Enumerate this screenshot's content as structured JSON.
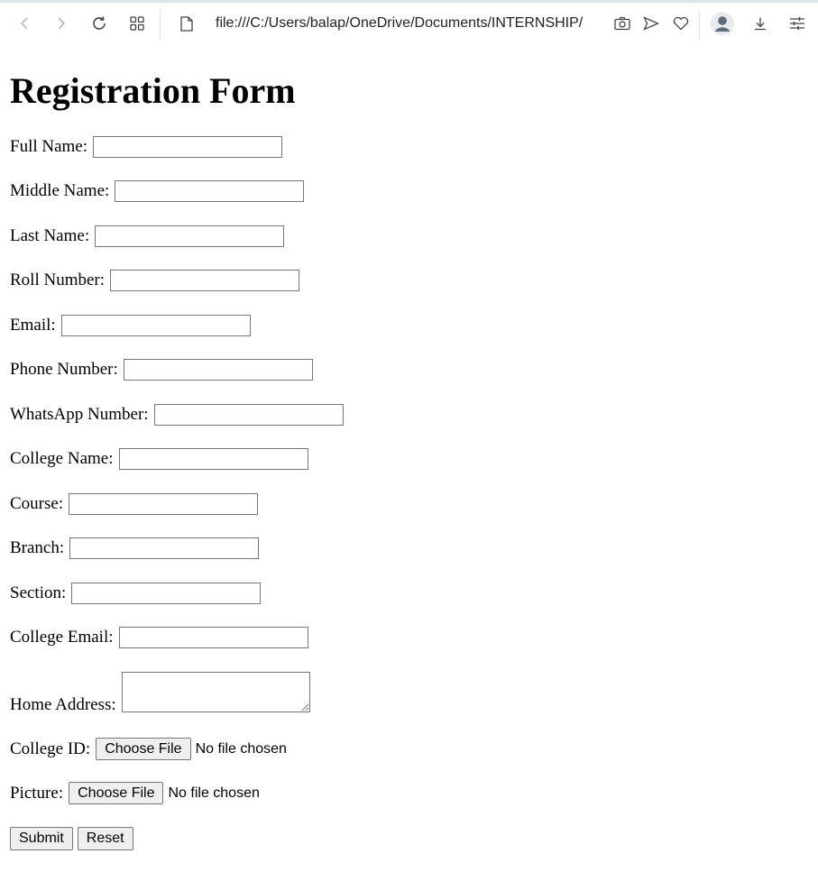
{
  "browser": {
    "url": "file:///C:/Users/balap/OneDrive/Documents/INTERNSHIP/"
  },
  "form": {
    "title": "Registration Form",
    "fields": [
      {
        "label": "Full Name:",
        "value": ""
      },
      {
        "label": "Middle Name:",
        "value": ""
      },
      {
        "label": "Last Name:",
        "value": ""
      },
      {
        "label": "Roll Number:",
        "value": ""
      },
      {
        "label": "Email:",
        "value": ""
      },
      {
        "label": "Phone Number:",
        "value": ""
      },
      {
        "label": "WhatsApp Number:",
        "value": ""
      },
      {
        "label": "College Name:",
        "value": ""
      },
      {
        "label": "Course:",
        "value": ""
      },
      {
        "label": "Branch:",
        "value": ""
      },
      {
        "label": "Section:",
        "value": ""
      },
      {
        "label": "College Email:",
        "value": ""
      }
    ],
    "home_address_label": "Home Address:",
    "college_id": {
      "label": "College ID:",
      "button": "Choose File",
      "status": "No file chosen"
    },
    "picture": {
      "label": "Picture:",
      "button": "Choose File",
      "status": "No file chosen"
    },
    "submit_label": "Submit",
    "reset_label": "Reset"
  }
}
